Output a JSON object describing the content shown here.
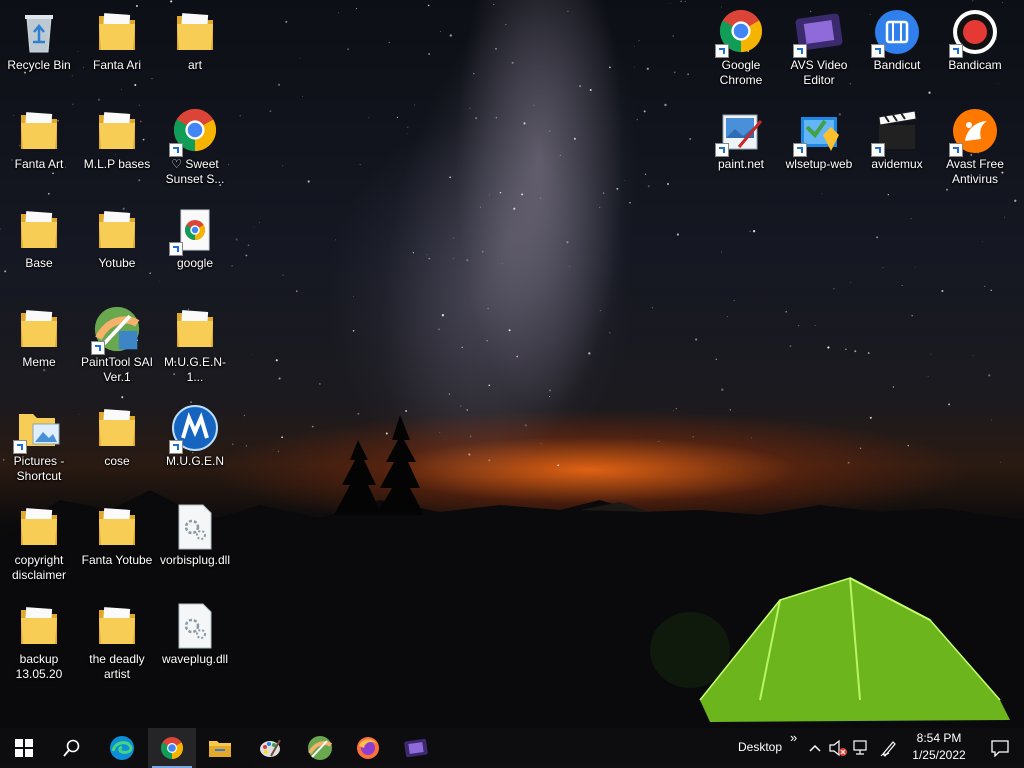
{
  "desktop_icons": [
    {
      "label": "Recycle Bin",
      "icon": "recycle-bin-icon"
    },
    {
      "label": "Fanta Ari",
      "icon": "folder-icon"
    },
    {
      "label": "art",
      "icon": "folder-icon"
    },
    {
      "label": "Fanta Art",
      "icon": "folder-icon"
    },
    {
      "label": "M.L.P bases",
      "icon": "folder-icon"
    },
    {
      "label": "♡ Sweet Sunset S...",
      "icon": "chrome-icon"
    },
    {
      "label": "Base",
      "icon": "folder-icon"
    },
    {
      "label": "Yotube",
      "icon": "folder-icon"
    },
    {
      "label": "google",
      "icon": "chrome-doc-icon"
    },
    {
      "label": "Meme",
      "icon": "folder-icon"
    },
    {
      "label": "PaintTool SAI Ver.1",
      "icon": "painttool-sai-icon"
    },
    {
      "label": "M.U.G.E.N-1...",
      "icon": "folder-icon"
    },
    {
      "label": "Pictures - Shortcut",
      "icon": "pictures-folder-icon"
    },
    {
      "label": "cose",
      "icon": "folder-icon"
    },
    {
      "label": "M.U.G.E.N",
      "icon": "mugen-icon"
    },
    {
      "label": "copyright disclaimer",
      "icon": "folder-icon"
    },
    {
      "label": "Fanta Yotube",
      "icon": "folder-icon"
    },
    {
      "label": "vorbisplug.dll",
      "icon": "dll-file-icon"
    },
    {
      "label": "backup 13.05.20",
      "icon": "folder-icon"
    },
    {
      "label": "the deadly artist",
      "icon": "folder-icon"
    },
    {
      "label": "waveplug.dll",
      "icon": "dll-file-icon"
    },
    {
      "label": "Google Chrome",
      "icon": "chrome-icon"
    },
    {
      "label": "AVS Video Editor",
      "icon": "avs-video-editor-icon"
    },
    {
      "label": "Bandicut",
      "icon": "bandicut-icon"
    },
    {
      "label": "Bandicam",
      "icon": "bandicam-icon"
    },
    {
      "label": "paint.net",
      "icon": "paint-net-icon"
    },
    {
      "label": "wlsetup-web",
      "icon": "windows-live-setup-icon"
    },
    {
      "label": "avidemux",
      "icon": "avidemux-icon"
    },
    {
      "label": "Avast Free Antivirus",
      "icon": "avast-icon"
    }
  ],
  "taskbar": {
    "pinned": [
      {
        "name": "start",
        "icon": "windows-start-icon"
      },
      {
        "name": "search",
        "icon": "search-icon"
      },
      {
        "name": "edge",
        "icon": "edge-icon"
      },
      {
        "name": "chrome",
        "icon": "chrome-icon",
        "active": true
      },
      {
        "name": "file-explorer",
        "icon": "file-explorer-icon"
      },
      {
        "name": "paint",
        "icon": "paint-palette-icon"
      },
      {
        "name": "painttool-sai",
        "icon": "painttool-sai-icon"
      },
      {
        "name": "firefox",
        "icon": "firefox-icon"
      },
      {
        "name": "avs-video-editor",
        "icon": "avs-video-editor-icon"
      }
    ],
    "toolbar_label": "Desktop",
    "overflow": "»",
    "tray_icons": [
      "chevron-up-icon",
      "speaker-muted-icon",
      "network-icon",
      "pen-icon"
    ],
    "clock_time": "8:54 PM",
    "clock_date": "1/25/2022",
    "notifications_icon": "notification-center-icon"
  },
  "colors": {
    "accent": "#7aa6e8",
    "taskbar_bg": "#0e0e10",
    "folder": "#f5c84c",
    "tent": "#7ed321"
  }
}
